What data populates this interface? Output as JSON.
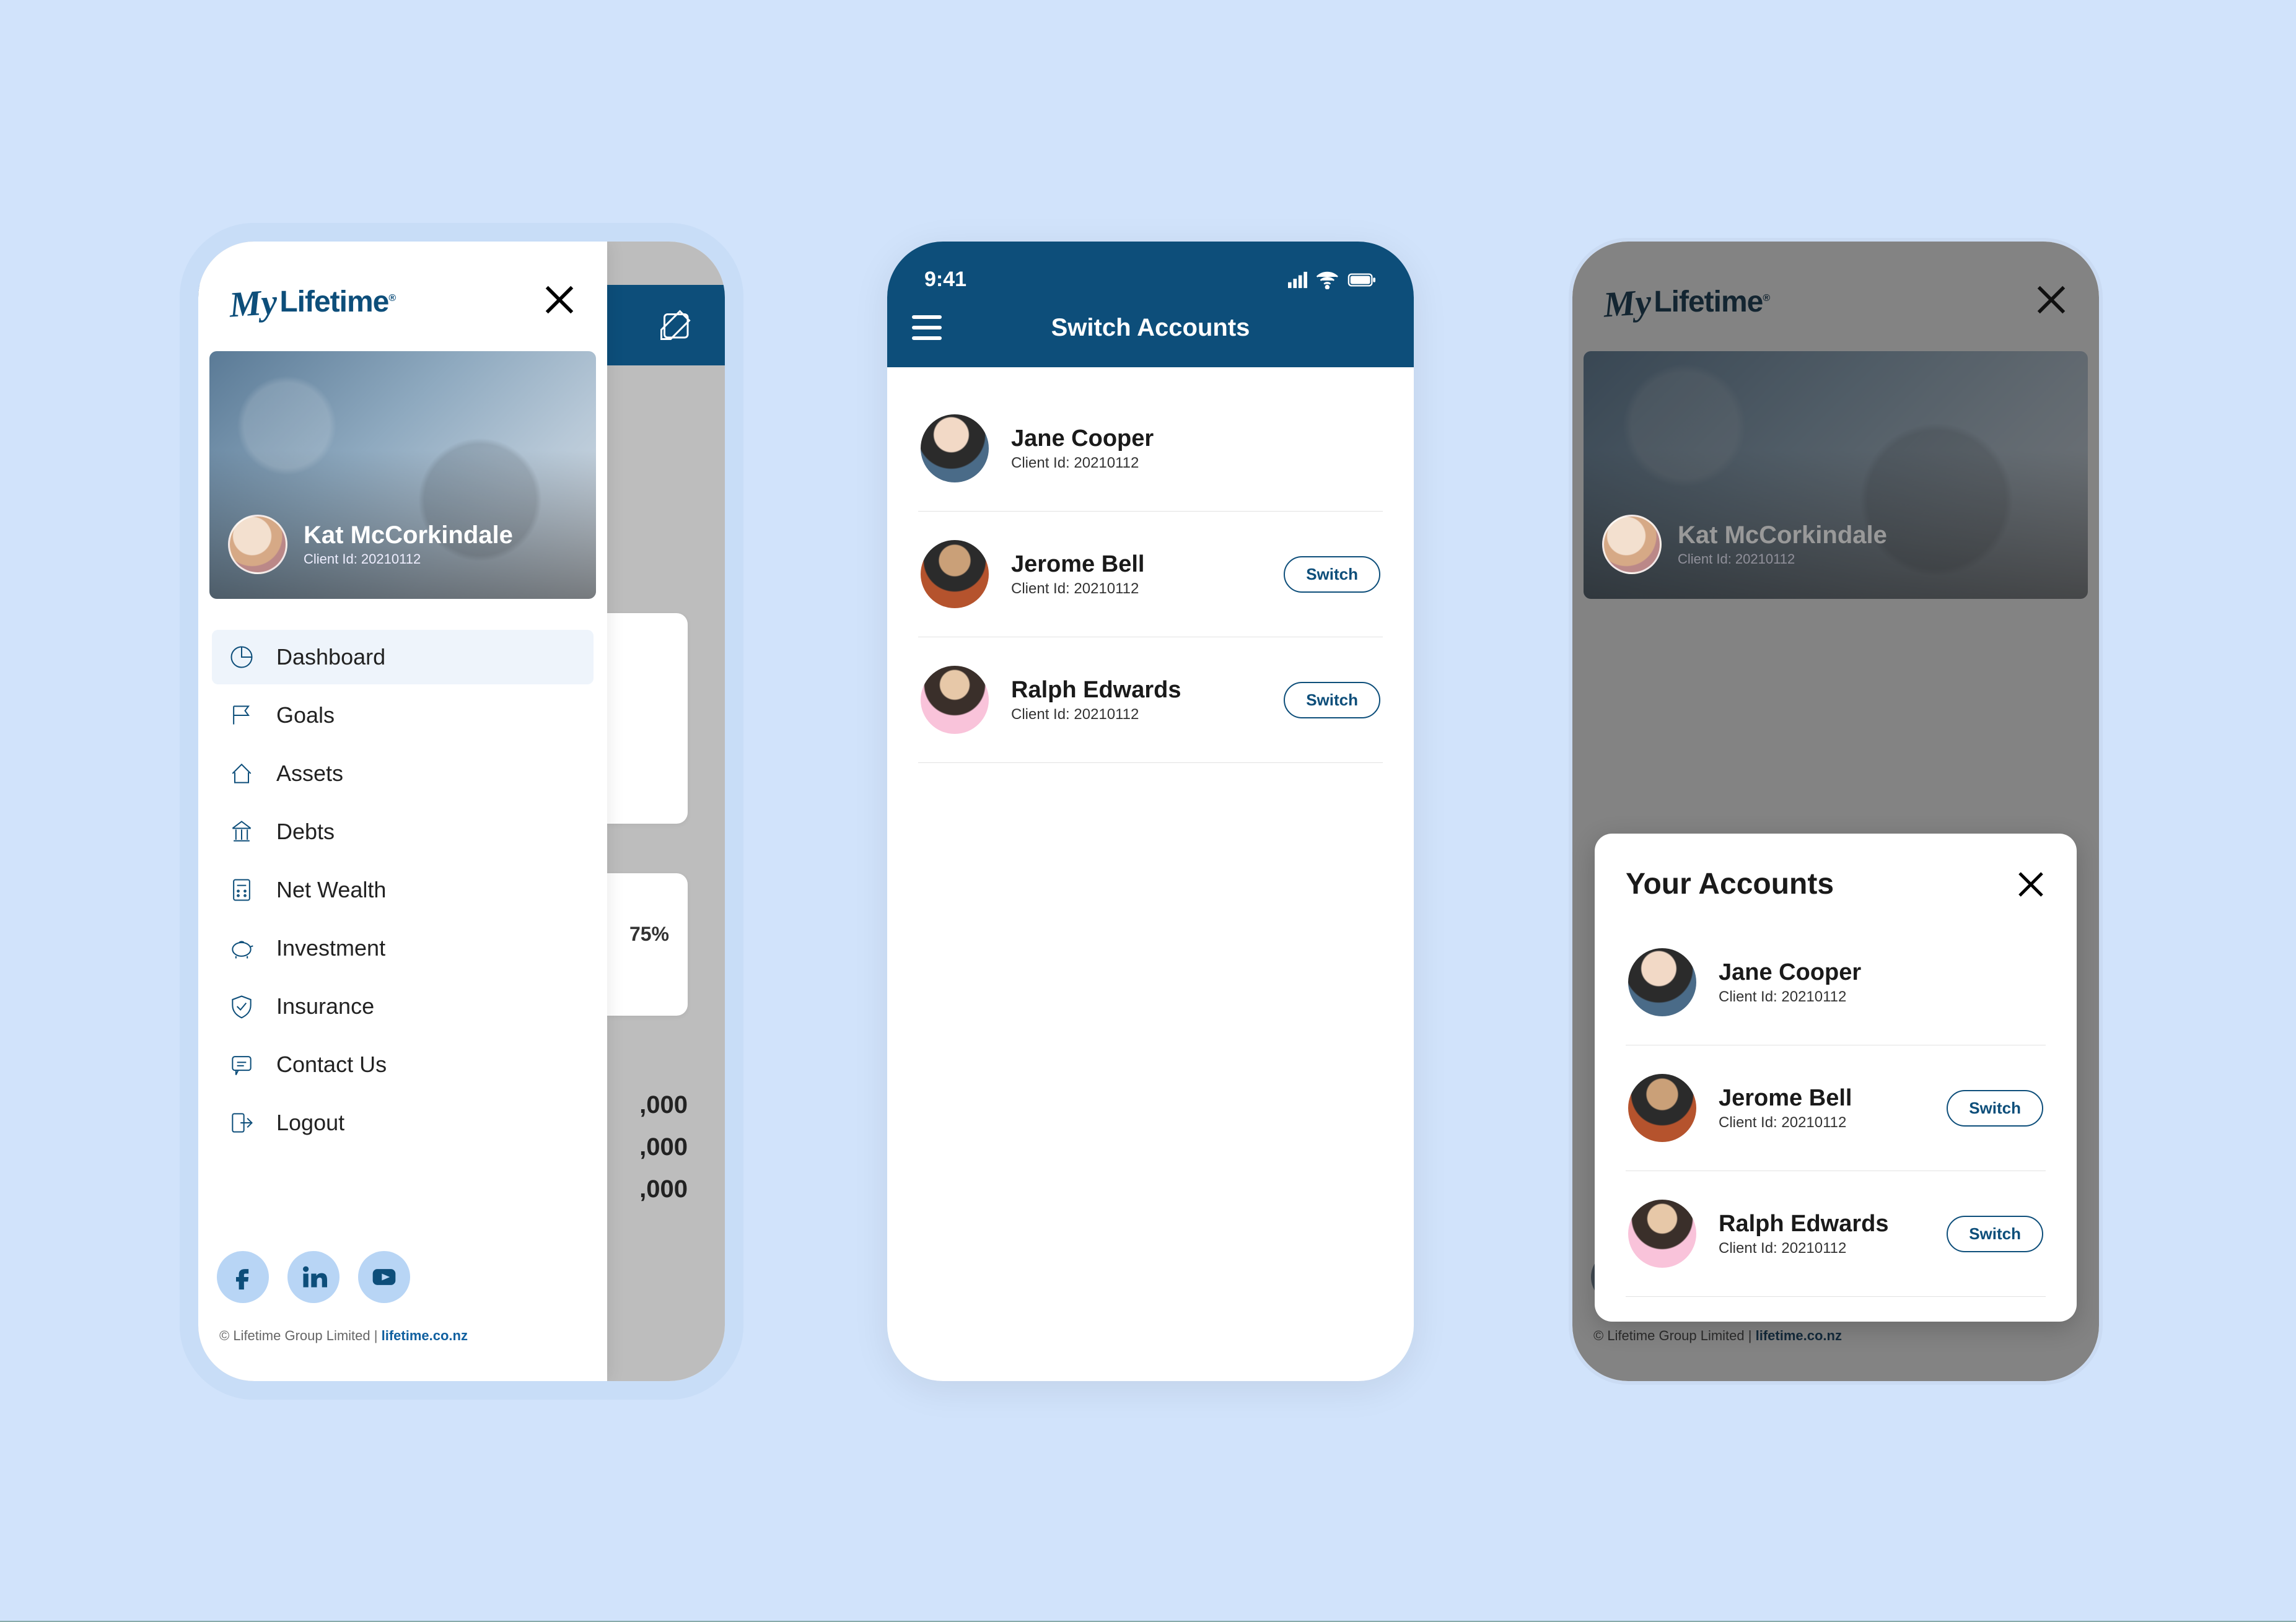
{
  "brand": {
    "my": "My",
    "lifetime": "Lifetime",
    "tm": "®"
  },
  "statusbar": {
    "time": "9:41"
  },
  "drawer": {
    "user": {
      "name": "Kat McCorkindale",
      "client_id_label": "Client Id: 20210112"
    },
    "nav": {
      "dashboard": "Dashboard",
      "goals": "Goals",
      "assets": "Assets",
      "debts": "Debts",
      "net_wealth": "Net Wealth",
      "investment": "Investment",
      "insurance": "Insurance",
      "contact": "Contact Us",
      "logout": "Logout"
    },
    "footer_prefix": "© Lifetime Group Limited | ",
    "footer_link": "lifetime.co.nz"
  },
  "behind": {
    "pct": "75%",
    "fig1": ",000",
    "fig2": ",000",
    "fig3": ",000"
  },
  "switch_page": {
    "title": "Switch Accounts",
    "switch_label": "Switch",
    "accounts": {
      "a0": {
        "name": "Jane Cooper",
        "id": "Client Id: 20210112"
      },
      "a1": {
        "name": "Jerome Bell",
        "id": "Client Id: 20210112"
      },
      "a2": {
        "name": "Ralph Edwards",
        "id": "Client Id: 20210112"
      }
    }
  },
  "modal": {
    "title": "Your Accounts",
    "switch_label": "Switch",
    "accounts": {
      "a0": {
        "name": "Jane Cooper",
        "id": "Client Id: 20210112"
      },
      "a1": {
        "name": "Jerome Bell",
        "id": "Client Id: 20210112"
      },
      "a2": {
        "name": "Ralph Edwards",
        "id": "Client Id: 20210112"
      }
    }
  }
}
